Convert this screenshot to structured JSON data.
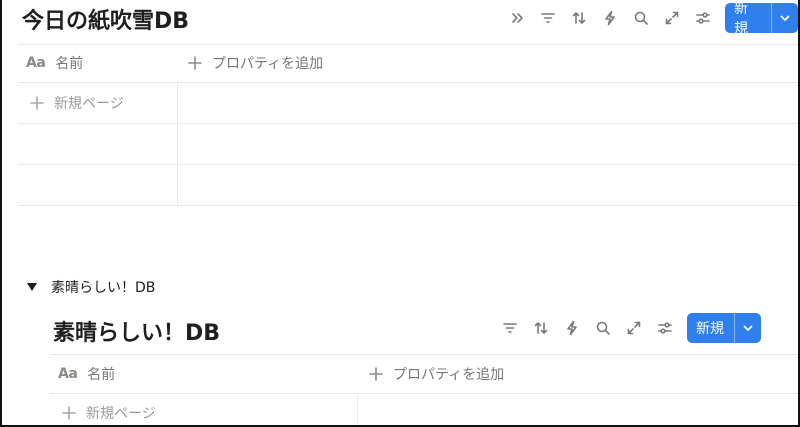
{
  "db1": {
    "title": "今日の紙吹雪DB",
    "toolbar_icons": [
      "expand-icon",
      "filter-icon",
      "sort-icon",
      "automation-icon",
      "search-icon",
      "fullscreen-icon",
      "settings-icon"
    ],
    "new_button_label": "新規",
    "columns": {
      "name": "名前",
      "add_property": "プロパティを追加"
    },
    "add_page_label": "新規ページ",
    "empty_rows": 2
  },
  "toggle_block": {
    "label": "素晴らしい！DB",
    "expanded": true
  },
  "db2": {
    "title": "素晴らしい！DB",
    "toolbar_icons": [
      "filter-icon",
      "sort-icon",
      "automation-icon",
      "search-icon",
      "fullscreen-icon",
      "settings-icon"
    ],
    "new_button_label": "新規",
    "columns": {
      "name": "名前",
      "add_property": "プロパティを追加"
    },
    "add_page_label": "新規ページ"
  },
  "colors": {
    "accent": "#2f80ed",
    "border": "#e9e9e7",
    "muted_text": "#787774"
  }
}
